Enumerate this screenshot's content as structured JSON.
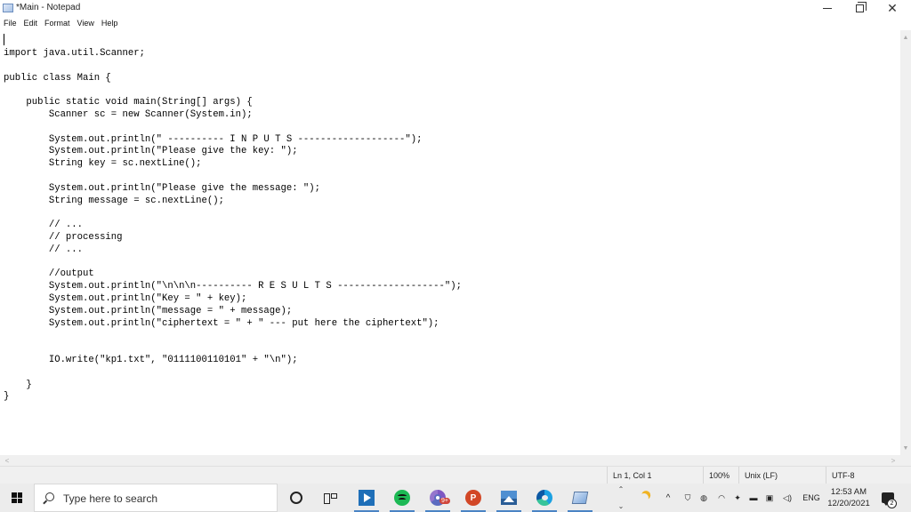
{
  "window": {
    "title": "*Main - Notepad",
    "minimize_glyph": "",
    "close_glyph": "✕"
  },
  "menu": [
    "File",
    "Edit",
    "Format",
    "View",
    "Help"
  ],
  "editor": {
    "lines": [
      "import java.util.Scanner;",
      "",
      "public class Main {",
      "",
      "    public static void main(String[] args) {",
      "        Scanner sc = new Scanner(System.in);",
      "",
      "        System.out.println(\" ---------- I N P U T S -------------------\");",
      "        System.out.println(\"Please give the key: \");",
      "        String key = sc.nextLine();",
      "",
      "        System.out.println(\"Please give the message: \");",
      "        String message = sc.nextLine();",
      "",
      "        // ...",
      "        // processing",
      "        // ...",
      "",
      "        //output",
      "        System.out.println(\"\\n\\n\\n---------- R E S U L T S -------------------\");",
      "        System.out.println(\"Key = \" + key);",
      "        System.out.println(\"message = \" + message);",
      "        System.out.println(\"ciphertext = \" + \" --- put here the ciphertext\");",
      "",
      "",
      "        IO.write(\"kp1.txt\", \"0111100110101\" + \"\\n\");",
      "",
      "    }",
      "}"
    ]
  },
  "status": {
    "position": "Ln 1, Col 1",
    "zoom": "100%",
    "line_endings": "Unix (LF)",
    "encoding": "UTF-8"
  },
  "taskbar": {
    "search_placeholder": "Type here to search",
    "chrome_badge": "9+",
    "ppt_letter": "P",
    "language": "ENG",
    "time": "12:53 AM",
    "date": "12/20/2021",
    "notification_count": "2",
    "accent_color": "#4a84c4"
  }
}
